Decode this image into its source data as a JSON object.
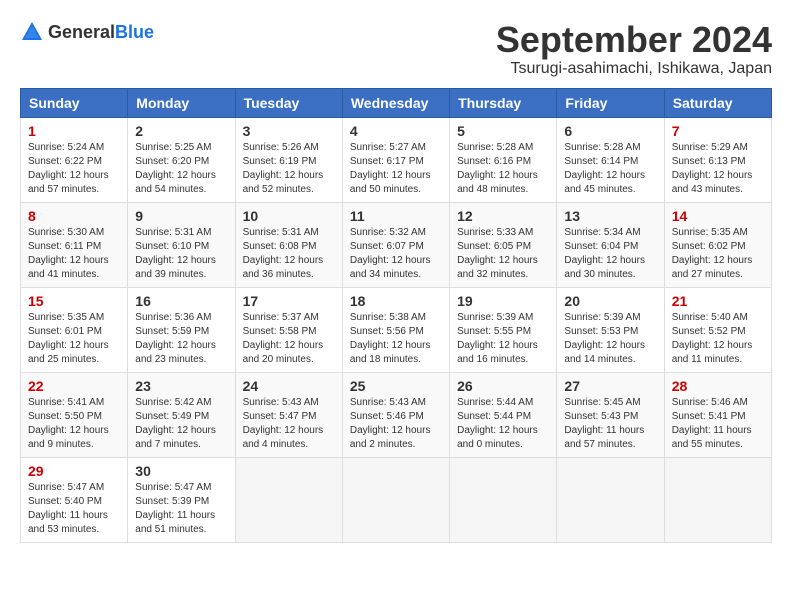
{
  "logo": {
    "text_general": "General",
    "text_blue": "Blue"
  },
  "header": {
    "month_title": "September 2024",
    "location": "Tsurugi-asahimachi, Ishikawa, Japan"
  },
  "columns": [
    "Sunday",
    "Monday",
    "Tuesday",
    "Wednesday",
    "Thursday",
    "Friday",
    "Saturday"
  ],
  "weeks": [
    [
      {
        "day": 1,
        "info": "Sunrise: 5:24 AM\nSunset: 6:22 PM\nDaylight: 12 hours\nand 57 minutes."
      },
      {
        "day": 2,
        "info": "Sunrise: 5:25 AM\nSunset: 6:20 PM\nDaylight: 12 hours\nand 54 minutes."
      },
      {
        "day": 3,
        "info": "Sunrise: 5:26 AM\nSunset: 6:19 PM\nDaylight: 12 hours\nand 52 minutes."
      },
      {
        "day": 4,
        "info": "Sunrise: 5:27 AM\nSunset: 6:17 PM\nDaylight: 12 hours\nand 50 minutes."
      },
      {
        "day": 5,
        "info": "Sunrise: 5:28 AM\nSunset: 6:16 PM\nDaylight: 12 hours\nand 48 minutes."
      },
      {
        "day": 6,
        "info": "Sunrise: 5:28 AM\nSunset: 6:14 PM\nDaylight: 12 hours\nand 45 minutes."
      },
      {
        "day": 7,
        "info": "Sunrise: 5:29 AM\nSunset: 6:13 PM\nDaylight: 12 hours\nand 43 minutes."
      }
    ],
    [
      {
        "day": 8,
        "info": "Sunrise: 5:30 AM\nSunset: 6:11 PM\nDaylight: 12 hours\nand 41 minutes."
      },
      {
        "day": 9,
        "info": "Sunrise: 5:31 AM\nSunset: 6:10 PM\nDaylight: 12 hours\nand 39 minutes."
      },
      {
        "day": 10,
        "info": "Sunrise: 5:31 AM\nSunset: 6:08 PM\nDaylight: 12 hours\nand 36 minutes."
      },
      {
        "day": 11,
        "info": "Sunrise: 5:32 AM\nSunset: 6:07 PM\nDaylight: 12 hours\nand 34 minutes."
      },
      {
        "day": 12,
        "info": "Sunrise: 5:33 AM\nSunset: 6:05 PM\nDaylight: 12 hours\nand 32 minutes."
      },
      {
        "day": 13,
        "info": "Sunrise: 5:34 AM\nSunset: 6:04 PM\nDaylight: 12 hours\nand 30 minutes."
      },
      {
        "day": 14,
        "info": "Sunrise: 5:35 AM\nSunset: 6:02 PM\nDaylight: 12 hours\nand 27 minutes."
      }
    ],
    [
      {
        "day": 15,
        "info": "Sunrise: 5:35 AM\nSunset: 6:01 PM\nDaylight: 12 hours\nand 25 minutes."
      },
      {
        "day": 16,
        "info": "Sunrise: 5:36 AM\nSunset: 5:59 PM\nDaylight: 12 hours\nand 23 minutes."
      },
      {
        "day": 17,
        "info": "Sunrise: 5:37 AM\nSunset: 5:58 PM\nDaylight: 12 hours\nand 20 minutes."
      },
      {
        "day": 18,
        "info": "Sunrise: 5:38 AM\nSunset: 5:56 PM\nDaylight: 12 hours\nand 18 minutes."
      },
      {
        "day": 19,
        "info": "Sunrise: 5:39 AM\nSunset: 5:55 PM\nDaylight: 12 hours\nand 16 minutes."
      },
      {
        "day": 20,
        "info": "Sunrise: 5:39 AM\nSunset: 5:53 PM\nDaylight: 12 hours\nand 14 minutes."
      },
      {
        "day": 21,
        "info": "Sunrise: 5:40 AM\nSunset: 5:52 PM\nDaylight: 12 hours\nand 11 minutes."
      }
    ],
    [
      {
        "day": 22,
        "info": "Sunrise: 5:41 AM\nSunset: 5:50 PM\nDaylight: 12 hours\nand 9 minutes."
      },
      {
        "day": 23,
        "info": "Sunrise: 5:42 AM\nSunset: 5:49 PM\nDaylight: 12 hours\nand 7 minutes."
      },
      {
        "day": 24,
        "info": "Sunrise: 5:43 AM\nSunset: 5:47 PM\nDaylight: 12 hours\nand 4 minutes."
      },
      {
        "day": 25,
        "info": "Sunrise: 5:43 AM\nSunset: 5:46 PM\nDaylight: 12 hours\nand 2 minutes."
      },
      {
        "day": 26,
        "info": "Sunrise: 5:44 AM\nSunset: 5:44 PM\nDaylight: 12 hours\nand 0 minutes."
      },
      {
        "day": 27,
        "info": "Sunrise: 5:45 AM\nSunset: 5:43 PM\nDaylight: 11 hours\nand 57 minutes."
      },
      {
        "day": 28,
        "info": "Sunrise: 5:46 AM\nSunset: 5:41 PM\nDaylight: 11 hours\nand 55 minutes."
      }
    ],
    [
      {
        "day": 29,
        "info": "Sunrise: 5:47 AM\nSunset: 5:40 PM\nDaylight: 11 hours\nand 53 minutes."
      },
      {
        "day": 30,
        "info": "Sunrise: 5:47 AM\nSunset: 5:39 PM\nDaylight: 11 hours\nand 51 minutes."
      },
      null,
      null,
      null,
      null,
      null
    ]
  ]
}
